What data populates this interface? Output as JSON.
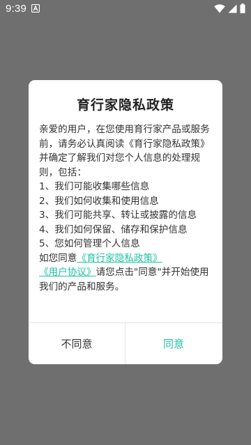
{
  "status_bar": {
    "time": "9:39",
    "icons": [
      "a-notification-icon",
      "wifi-icon",
      "signal-icon",
      "battery-icon"
    ]
  },
  "dialog": {
    "title": "育行家隐私政策",
    "intro": "亲爱的用户，在您使用育行家产品或服务 前，请务必认真阅读《育行家隐私政策》 并确定了解我们对您个人信息的处理规则，包括：",
    "items": [
      "1、我们可能收集哪些信息",
      "2、我们如何收集和使用信息",
      "3、我们可能共享、转让或披露的信息",
      "4、我们如何保留、储存和保护信息",
      "5、您如何管理个人信息"
    ],
    "consent_prefix": "如您同意",
    "privacy_link": "《育行家隐私政策》",
    "agreement_link": "《用户协议》",
    "consent_suffix": "请您点击\"同意\"并开始使用我们的产品和服务。",
    "decline_label": "不同意",
    "agree_label": "同意"
  },
  "colors": {
    "accent": "#1ec3a0",
    "overlay": "#6f6f6f",
    "dialog_bg": "#ffffff"
  }
}
